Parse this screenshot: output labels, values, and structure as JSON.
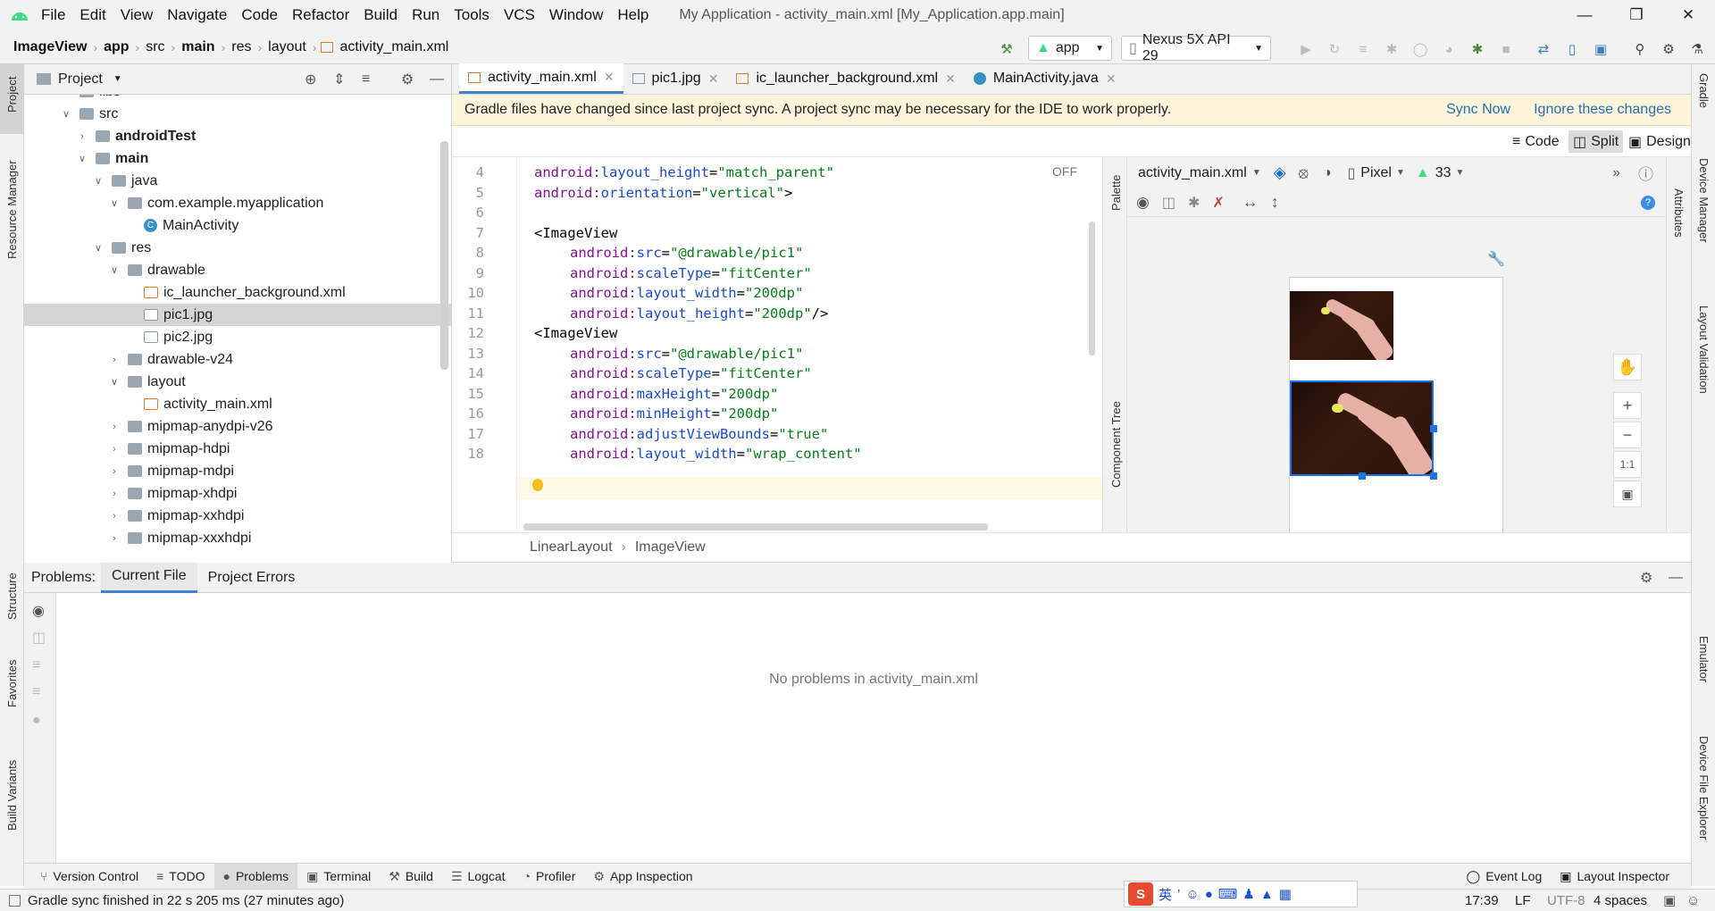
{
  "app": {
    "window_title": "My Application - activity_main.xml [My_Application.app.main]",
    "menu": [
      "File",
      "Edit",
      "View",
      "Navigate",
      "Code",
      "Refactor",
      "Build",
      "Run",
      "Tools",
      "VCS",
      "Window",
      "Help"
    ]
  },
  "breadcrumb": [
    "ImageView",
    "app",
    "src",
    "main",
    "res",
    "layout",
    "activity_main.xml"
  ],
  "toolbar": {
    "run_config": "app",
    "device": "Nexus 5X API 29"
  },
  "left_strip": [
    "Project",
    "Resource Manager",
    "Structure",
    "Favorites",
    "Build Variants"
  ],
  "right_strip": [
    "Gradle",
    "Device Manager",
    "Layout Validation",
    "Emulator",
    "Device File Explorer"
  ],
  "project": {
    "header": "Project",
    "tree": [
      {
        "label": "libs",
        "arrow": "",
        "icon": "folder",
        "bold": false
      },
      {
        "label": "src",
        "arrow": "v",
        "icon": "folder",
        "bold": false
      },
      {
        "label": "androidTest",
        "arrow": ">",
        "icon": "folder",
        "bold": true
      },
      {
        "label": "main",
        "arrow": "v",
        "icon": "folder",
        "bold": true
      },
      {
        "label": "java",
        "arrow": "v",
        "icon": "folder",
        "bold": false
      },
      {
        "label": "com.example.myapplication",
        "arrow": "v",
        "icon": "folder",
        "bold": false
      },
      {
        "label": "MainActivity",
        "arrow": "",
        "icon": "class",
        "bold": false
      },
      {
        "label": "res",
        "arrow": "v",
        "icon": "folder",
        "bold": false
      },
      {
        "label": "drawable",
        "arrow": "v",
        "icon": "folder",
        "bold": false
      },
      {
        "label": "ic_launcher_background.xml",
        "arrow": "",
        "icon": "xml",
        "bold": false
      },
      {
        "label": "pic1.jpg",
        "arrow": "",
        "icon": "jpg",
        "bold": false,
        "selected": true
      },
      {
        "label": "pic2.jpg",
        "arrow": "",
        "icon": "jpg",
        "bold": false
      },
      {
        "label": "drawable-v24",
        "arrow": ">",
        "icon": "folder",
        "bold": false
      },
      {
        "label": "layout",
        "arrow": "v",
        "icon": "folder",
        "bold": false
      },
      {
        "label": "activity_main.xml",
        "arrow": "",
        "icon": "xml",
        "bold": false
      },
      {
        "label": "mipmap-anydpi-v26",
        "arrow": ">",
        "icon": "folder",
        "bold": false
      },
      {
        "label": "mipmap-hdpi",
        "arrow": ">",
        "icon": "folder",
        "bold": false
      },
      {
        "label": "mipmap-mdpi",
        "arrow": ">",
        "icon": "folder",
        "bold": false
      },
      {
        "label": "mipmap-xhdpi",
        "arrow": ">",
        "icon": "folder",
        "bold": false
      },
      {
        "label": "mipmap-xxhdpi",
        "arrow": ">",
        "icon": "folder",
        "bold": false
      },
      {
        "label": "mipmap-xxxhdpi",
        "arrow": ">",
        "icon": "folder",
        "bold": false
      }
    ]
  },
  "editor_tabs": [
    {
      "label": "activity_main.xml",
      "active": true
    },
    {
      "label": "pic1.jpg",
      "active": false
    },
    {
      "label": "ic_launcher_background.xml",
      "active": false
    },
    {
      "label": "MainActivity.java",
      "active": false
    }
  ],
  "banner": {
    "message": "Gradle files have changed since last project sync. A project sync may be necessary for the IDE to work properly.",
    "sync": "Sync Now",
    "ignore": "Ignore these changes"
  },
  "modes": {
    "code": "Code",
    "split": "Split",
    "design": "Design"
  },
  "code": {
    "off_label": "OFF",
    "lines": [
      {
        "n": "4",
        "parts": [
          [
            "a",
            "android:"
          ],
          [
            "an",
            "layout_height"
          ],
          [
            "t",
            "="
          ],
          [
            "v",
            "\"match_parent\""
          ]
        ],
        "indent": 1
      },
      {
        "n": "5",
        "parts": [
          [
            "a",
            "android:"
          ],
          [
            "an",
            "orientation"
          ],
          [
            "t",
            "="
          ],
          [
            "v",
            "\"vertical\""
          ],
          [
            "t",
            ">"
          ]
        ],
        "indent": 1
      },
      {
        "n": "6",
        "parts": [],
        "indent": 1
      },
      {
        "n": "7",
        "parts": [
          [
            "t",
            "<ImageView"
          ]
        ],
        "indent": 1
      },
      {
        "n": "8",
        "parts": [
          [
            "a",
            "android:"
          ],
          [
            "an",
            "src"
          ],
          [
            "t",
            "="
          ],
          [
            "v",
            "\"@drawable/pic1\""
          ]
        ],
        "indent": 2
      },
      {
        "n": "9",
        "parts": [
          [
            "a",
            "android:"
          ],
          [
            "an",
            "scaleType"
          ],
          [
            "t",
            "="
          ],
          [
            "v",
            "\"fitCenter\""
          ]
        ],
        "indent": 2
      },
      {
        "n": "10",
        "parts": [
          [
            "a",
            "android:"
          ],
          [
            "an",
            "layout_width"
          ],
          [
            "t",
            "="
          ],
          [
            "v",
            "\"200dp\""
          ]
        ],
        "indent": 2
      },
      {
        "n": "11",
        "parts": [
          [
            "a",
            "android:"
          ],
          [
            "an",
            "layout_height"
          ],
          [
            "t",
            "="
          ],
          [
            "v",
            "\"200dp\""
          ],
          [
            "t",
            "/>"
          ]
        ],
        "indent": 2
      },
      {
        "n": "12",
        "parts": [
          [
            "t",
            "<ImageView"
          ]
        ],
        "indent": 1
      },
      {
        "n": "13",
        "parts": [
          [
            "a",
            "android:"
          ],
          [
            "an",
            "src"
          ],
          [
            "t",
            "="
          ],
          [
            "v",
            "\"@drawable/pic1\""
          ]
        ],
        "indent": 2
      },
      {
        "n": "14",
        "parts": [
          [
            "a",
            "android:"
          ],
          [
            "an",
            "scaleType"
          ],
          [
            "t",
            "="
          ],
          [
            "v",
            "\"fitCenter\""
          ]
        ],
        "indent": 2
      },
      {
        "n": "15",
        "parts": [
          [
            "a",
            "android:"
          ],
          [
            "an",
            "maxHeight"
          ],
          [
            "t",
            "="
          ],
          [
            "v",
            "\"200dp\""
          ]
        ],
        "indent": 2
      },
      {
        "n": "16",
        "parts": [
          [
            "a",
            "android:"
          ],
          [
            "an",
            "minHeight"
          ],
          [
            "t",
            "="
          ],
          [
            "v",
            "\"200dp\""
          ]
        ],
        "indent": 2
      },
      {
        "n": "17",
        "parts": [
          [
            "a",
            "android:"
          ],
          [
            "an",
            "adjustViewBounds"
          ],
          [
            "t",
            "="
          ],
          [
            "v",
            "\"true\""
          ]
        ],
        "indent": 2
      },
      {
        "n": "18",
        "parts": [
          [
            "a",
            "android:"
          ],
          [
            "an",
            "layout_width"
          ],
          [
            "t",
            "="
          ],
          [
            "v",
            "\"wrap_content\""
          ]
        ],
        "indent": 2
      }
    ]
  },
  "design": {
    "file": "activity_main.xml",
    "device": "Pixel",
    "api": "33"
  },
  "side_tabs": {
    "palette": "Palette",
    "component_tree": "Component Tree",
    "attributes": "Attributes"
  },
  "zoom": {
    "one_to_one": "1:1"
  },
  "element_crumb": [
    "LinearLayout",
    "ImageView"
  ],
  "problems": {
    "label": "Problems:",
    "tabs": [
      "Current File",
      "Project Errors"
    ],
    "empty": "No problems in activity_main.xml"
  },
  "tool_windows": [
    {
      "label": "Version Control",
      "active": false
    },
    {
      "label": "TODO",
      "active": false
    },
    {
      "label": "Problems",
      "active": true
    },
    {
      "label": "Terminal",
      "active": false
    },
    {
      "label": "Build",
      "active": false
    },
    {
      "label": "Logcat",
      "active": false
    },
    {
      "label": "Profiler",
      "active": false
    },
    {
      "label": "App Inspection",
      "active": false
    }
  ],
  "right_tools": [
    "Event Log",
    "Layout Inspector"
  ],
  "status": {
    "message": "Gradle sync finished in 22 s 205 ms (27 minutes ago)",
    "ime": [
      "英"
    ],
    "position": "17:39",
    "line_sep": "LF",
    "encoding": "UTF-8",
    "indent": "4 spaces"
  },
  "colors": {
    "accent": "#4083c9",
    "android_green": "#3ddc84",
    "banner": "#fcf5dc",
    "selection": "#1a73e8"
  }
}
